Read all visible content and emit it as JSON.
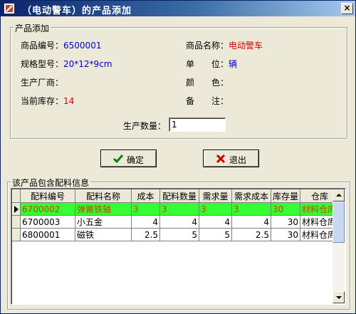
{
  "window": {
    "title": "（电动警车）的产品添加",
    "close_label": "×"
  },
  "product_group": {
    "label": "产品添加",
    "code_label": "商品编号：",
    "code_value": "6500001",
    "name_label": "商品名称：",
    "name_value": "电动警车",
    "spec_label": "规格型号：",
    "spec_value": "20*12*9cm",
    "unit_label": "单　　位：",
    "unit_value": "辆",
    "maker_label": "生产厂商：",
    "maker_value": "",
    "color_label": "颜　　色：",
    "color_value": "",
    "stock_label": "当前库存：",
    "stock_value": "14",
    "note_label": "备　　注：",
    "note_value": "",
    "qty_label": "生产数量：",
    "qty_value": "1"
  },
  "buttons": {
    "ok_label": "确定",
    "exit_label": "退出"
  },
  "parts_group": {
    "label": "该产品包含配料信息",
    "columns": [
      "配料编号",
      "配料名称",
      "成本",
      "配料数量",
      "需求量",
      "需求成本",
      "库存量",
      "仓库"
    ],
    "rows": [
      [
        "6700002",
        "弹簧铁轴",
        "3",
        "3",
        "3",
        "3",
        "30",
        "材料仓库"
      ],
      [
        "6700003",
        "小五金",
        "4",
        "4",
        "4",
        "4",
        "30",
        "材料仓库"
      ],
      [
        "6800001",
        "磁铁",
        "2.5",
        "5",
        "5",
        "2.5",
        "30",
        "材料仓库"
      ]
    ]
  },
  "colors": {
    "selected_row_bg": "#33ff33",
    "selected_row_text": "#d04000",
    "value_blue": "#0000c0",
    "value_red": "#d00000",
    "titlebar": "#0a246a"
  },
  "icons": {
    "title": "app-icon",
    "ok": "check-icon",
    "exit": "x-icon"
  }
}
